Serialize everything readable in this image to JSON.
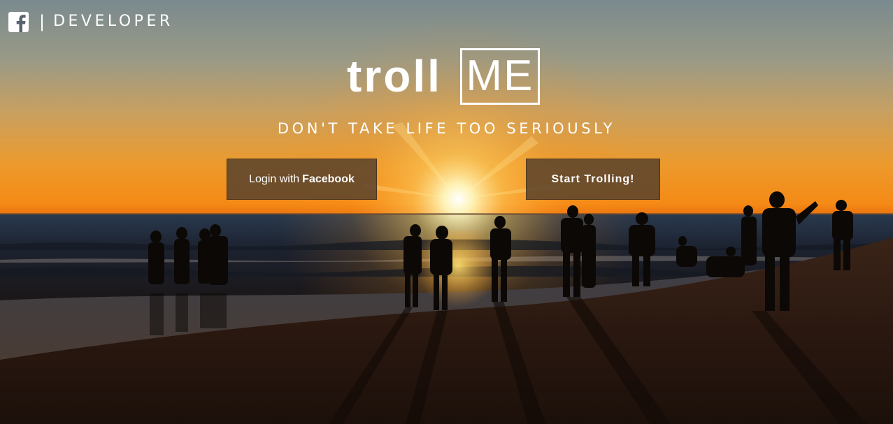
{
  "header": {
    "brand_separator": "|",
    "brand_label": "DEVELOPER",
    "logo_icon": "facebook-icon"
  },
  "hero": {
    "title_part1": "troll",
    "title_part2": "ME",
    "tagline": "DON'T TAKE LIFE TOO SERIOUSLY",
    "background": "sunset-beach-photo"
  },
  "actions": {
    "login_prefix": "Login with",
    "login_bold": "Facebook",
    "start_label": "Start Trolling!"
  },
  "colors": {
    "button_bg": "#5c442c",
    "text": "#ffffff",
    "sky_top": "#7b8a8e",
    "sun": "#fff6c8",
    "horizon": "#f08a1c"
  }
}
